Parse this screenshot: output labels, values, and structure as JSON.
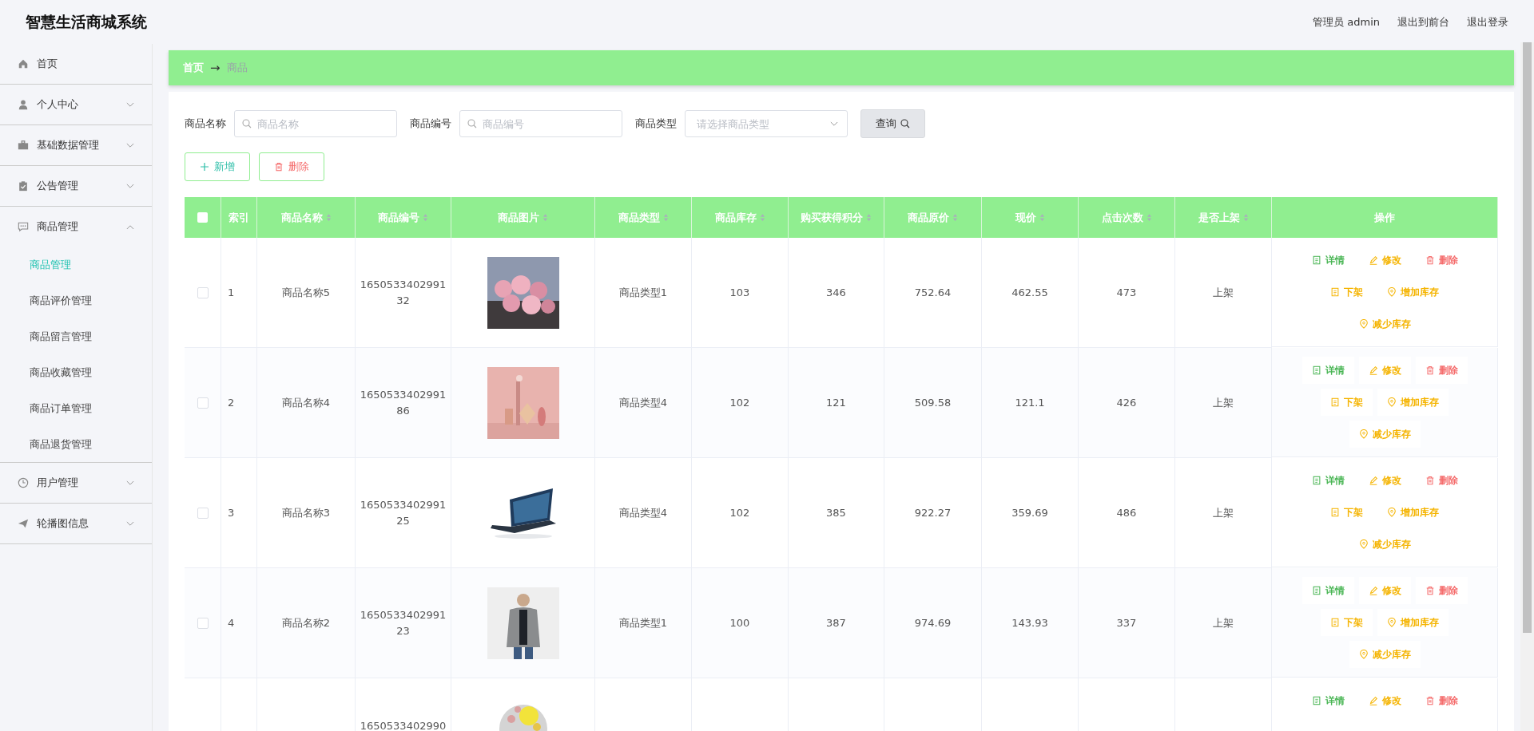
{
  "app_title": "智慧生活商城系统",
  "header_links": [
    "管理员 admin",
    "退出到前台",
    "退出登录"
  ],
  "sidebar": {
    "items": [
      {
        "label": "首页",
        "expandable": false,
        "expanded": false
      },
      {
        "label": "个人中心",
        "expandable": true,
        "expanded": false
      },
      {
        "label": "基础数据管理",
        "expandable": true,
        "expanded": false
      },
      {
        "label": "公告管理",
        "expandable": true,
        "expanded": false
      },
      {
        "label": "商品管理",
        "expandable": true,
        "expanded": true,
        "children": [
          {
            "label": "商品管理",
            "selected": true
          },
          {
            "label": "商品评价管理",
            "selected": false
          },
          {
            "label": "商品留言管理",
            "selected": false
          },
          {
            "label": "商品收藏管理",
            "selected": false
          },
          {
            "label": "商品订单管理",
            "selected": false
          },
          {
            "label": "商品退货管理",
            "selected": false
          }
        ]
      },
      {
        "label": "用户管理",
        "expandable": true,
        "expanded": false
      },
      {
        "label": "轮播图信息",
        "expandable": true,
        "expanded": false
      }
    ]
  },
  "breadcrumb": {
    "items": [
      "首页",
      "商品"
    ],
    "separator": "→"
  },
  "filters": [
    {
      "kind": "search",
      "label": "商品名称",
      "placeholder": "商品名称"
    },
    {
      "kind": "search",
      "label": "商品编号",
      "placeholder": "商品编号"
    },
    {
      "kind": "select",
      "label": "商品类型",
      "placeholder": "请选择商品类型"
    }
  ],
  "query_button": "查询",
  "toolbar": [
    {
      "kind": "add",
      "label": "新增"
    },
    {
      "kind": "delete",
      "label": "删除"
    }
  ],
  "table": {
    "header_checked": false,
    "columns": [
      {
        "label": "索引",
        "sortable": false
      },
      {
        "label": "商品名称",
        "sortable": true
      },
      {
        "label": "商品编号",
        "sortable": true
      },
      {
        "label": "商品图片",
        "sortable": true
      },
      {
        "label": "商品类型",
        "sortable": true
      },
      {
        "label": "商品库存",
        "sortable": true
      },
      {
        "label": "购买获得积分",
        "sortable": true
      },
      {
        "label": "商品原价",
        "sortable": true
      },
      {
        "label": "现价",
        "sortable": true
      },
      {
        "label": "点击次数",
        "sortable": true
      },
      {
        "label": "是否上架",
        "sortable": true
      },
      {
        "label": "操作",
        "sortable": false
      }
    ],
    "rows": [
      {
        "checked": false,
        "cells": [
          "1",
          "商品名称5",
          "165053340299132",
          null,
          "商品类型1",
          "103",
          "346",
          "752.64",
          "462.55",
          "473",
          "上架"
        ],
        "actions": [
          {
            "kind": "detail",
            "label": "详情"
          },
          {
            "kind": "edit",
            "label": "修改"
          },
          {
            "kind": "delete",
            "label": "删除"
          },
          {
            "kind": "shelf",
            "label": "下架"
          },
          {
            "kind": "stock",
            "label": "增加库存"
          },
          {
            "kind": "stock",
            "label": "减少库存"
          }
        ]
      },
      {
        "checked": false,
        "cells": [
          "2",
          "商品名称4",
          "165053340299186",
          null,
          "商品类型4",
          "102",
          "121",
          "509.58",
          "121.1",
          "426",
          "上架"
        ],
        "actions": [
          {
            "kind": "detail",
            "label": "详情"
          },
          {
            "kind": "edit",
            "label": "修改"
          },
          {
            "kind": "delete",
            "label": "删除"
          },
          {
            "kind": "shelf",
            "label": "下架"
          },
          {
            "kind": "stock",
            "label": "增加库存"
          },
          {
            "kind": "stock",
            "label": "减少库存"
          }
        ]
      },
      {
        "checked": false,
        "cells": [
          "3",
          "商品名称3",
          "165053340299125",
          null,
          "商品类型4",
          "102",
          "385",
          "922.27",
          "359.69",
          "486",
          "上架"
        ],
        "actions": [
          {
            "kind": "detail",
            "label": "详情"
          },
          {
            "kind": "edit",
            "label": "修改"
          },
          {
            "kind": "delete",
            "label": "删除"
          },
          {
            "kind": "shelf",
            "label": "下架"
          },
          {
            "kind": "stock",
            "label": "增加库存"
          },
          {
            "kind": "stock",
            "label": "减少库存"
          }
        ]
      },
      {
        "checked": false,
        "cells": [
          "4",
          "商品名称2",
          "165053340299123",
          null,
          "商品类型1",
          "100",
          "387",
          "974.69",
          "143.93",
          "337",
          "上架"
        ],
        "actions": [
          {
            "kind": "detail",
            "label": "详情"
          },
          {
            "kind": "edit",
            "label": "修改"
          },
          {
            "kind": "delete",
            "label": "删除"
          },
          {
            "kind": "shelf",
            "label": "下架"
          },
          {
            "kind": "stock",
            "label": "增加库存"
          },
          {
            "kind": "stock",
            "label": "减少库存"
          }
        ]
      },
      {
        "cells": [
          null,
          null,
          "1650533402990",
          null,
          null,
          null,
          null,
          null,
          null,
          null,
          null
        ],
        "actions": [
          {
            "kind": "detail",
            "label": "详情"
          },
          {
            "kind": "edit",
            "label": "修改"
          },
          {
            "kind": "delete",
            "label": "删除"
          }
        ]
      }
    ]
  }
}
